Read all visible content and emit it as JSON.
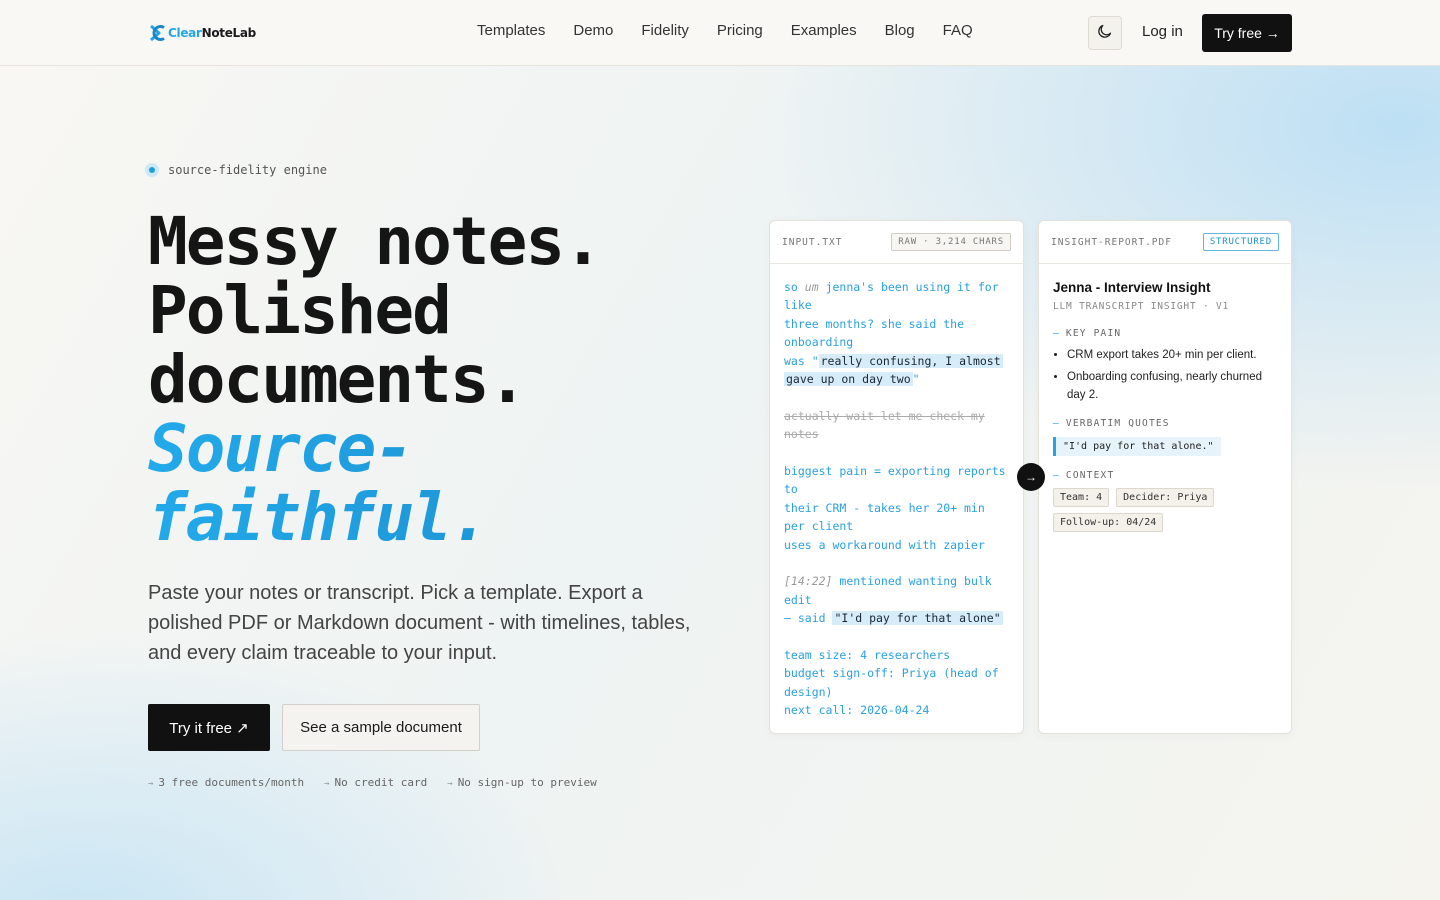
{
  "header": {
    "logo": {
      "part1": "Clear",
      "part2": "NoteLab",
      "icon": "clearnotelab-logo-icon"
    },
    "nav": [
      "Templates",
      "Demo",
      "Fidelity",
      "Pricing",
      "Examples",
      "Blog",
      "FAQ"
    ],
    "theme_icon": "moon-icon",
    "login_label": "Log in",
    "try_label": "Try free →"
  },
  "hero": {
    "badge": "source-fidelity engine",
    "title_lines": [
      "Messy notes.",
      "Polished",
      "documents."
    ],
    "accent_lines": [
      "Source-",
      "faithful."
    ],
    "subtitle": "Paste your notes or transcript. Pick a template. Export a polished PDF or Markdown document - with timelines, tables, and every claim traceable to your input.",
    "cta_primary": "Try it free ↗",
    "cta_secondary": "See a sample document",
    "perks": [
      "3 free documents/month",
      "No credit card",
      "No sign-up to preview"
    ]
  },
  "input_panel": {
    "title": "INPUT.TXT",
    "tag": "RAW · 3,214 CHARS",
    "lines": {
      "l1a": "so ",
      "l1b": "um",
      "l1c": " jenna's been using it for",
      "l2": "like",
      "l3": "three months? she said the",
      "l4": "onboarding",
      "l5a": "was \"",
      "l5b": "really confusing, I almost",
      "l6a": "gave up on day two",
      "l6b": "\"",
      "l7": "actually wait let me check my",
      "l8": "notes",
      "l9": "biggest pain = exporting reports",
      "l10": "to",
      "l11": "their CRM - takes her 20+ min",
      "l12": "per client",
      "l13": "uses a workaround with zapier",
      "l14a": "[14:22]",
      "l14b": " mentioned wanting bulk",
      "l15": "edit",
      "l16a": "– said ",
      "l16b": "\"I'd pay for that alone\"",
      "l17": "team size: 4 researchers",
      "l18": "budget sign-off: Priya (head of",
      "l19": "design)",
      "l20": "next call: 2026-04-24"
    }
  },
  "arrow_label": "→",
  "output_panel": {
    "title": "INSIGHT-REPORT.PDF",
    "tag": "STRUCTURED",
    "doc_title": "Jenna - Interview Insight",
    "doc_meta": "LLM TRANSCRIPT INSIGHT · V1",
    "sections": {
      "key_pain": {
        "label": "KEY PAIN",
        "items": [
          "CRM export takes 20+ min per client.",
          "Onboarding confusing, nearly churned day 2."
        ]
      },
      "quotes": {
        "label": "VERBATIM QUOTES",
        "items": [
          "\"I'd pay for that alone.\""
        ]
      },
      "context": {
        "label": "CONTEXT",
        "chips": [
          "Team: 4",
          "Decider: Priya",
          "Follow-up: 04/24"
        ]
      }
    },
    "dash": "—"
  },
  "colors": {
    "accent": "#22a7e6",
    "dark": "#111111"
  }
}
